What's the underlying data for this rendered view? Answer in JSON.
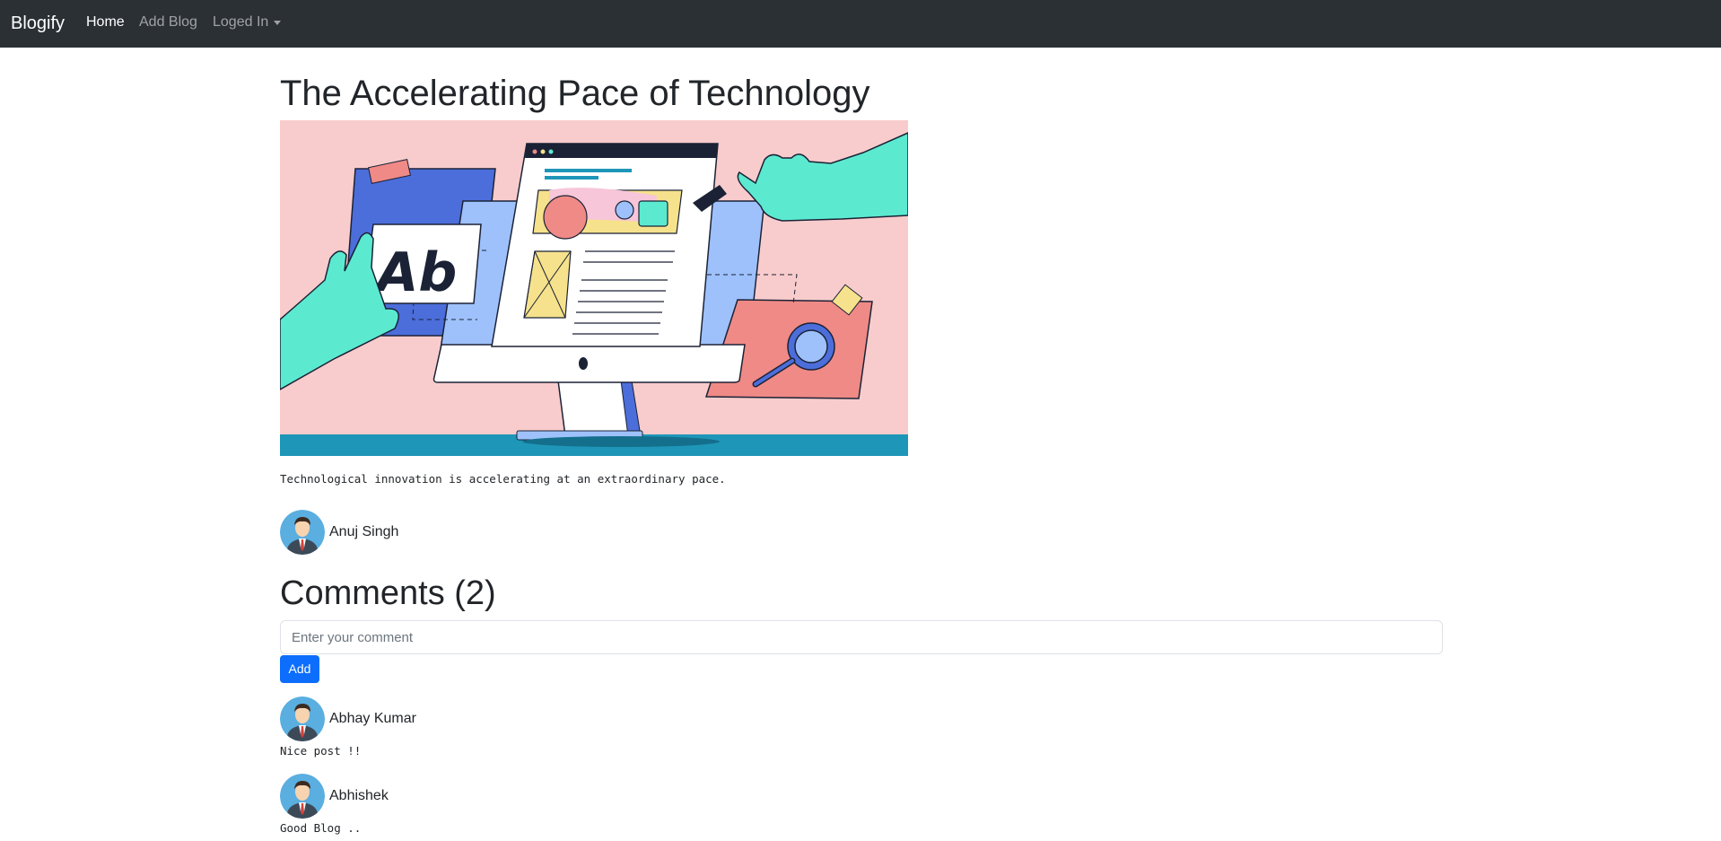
{
  "navbar": {
    "brand": "Blogify",
    "links": [
      {
        "label": "Home",
        "active": true
      },
      {
        "label": "Add Blog",
        "active": false
      },
      {
        "label": "Loged In",
        "active": false,
        "dropdown": true
      }
    ]
  },
  "post": {
    "title": "The Accelerating Pace of Technology",
    "hero_image": {
      "icon": "web-design-illustration",
      "text": "Ab"
    },
    "description": "Technological innovation is accelerating at an extraordinary pace.",
    "author": {
      "name": "Anuj Singh",
      "avatar": "user-avatar-icon"
    }
  },
  "comments": {
    "heading": "Comments (2)",
    "input_placeholder": "Enter your comment",
    "input_value": "",
    "add_label": "Add",
    "items": [
      {
        "author": "Abhay Kumar",
        "avatar": "user-avatar-icon",
        "text": "Nice post !!"
      },
      {
        "author": "Abhishek",
        "avatar": "user-avatar-icon",
        "text": "Good Blog .."
      }
    ]
  },
  "colors": {
    "navbar_bg": "#2b3035",
    "primary_button": "#0d6efd",
    "hero_bg": "#f8cccc",
    "avatar_bg": "#5aaee0"
  }
}
